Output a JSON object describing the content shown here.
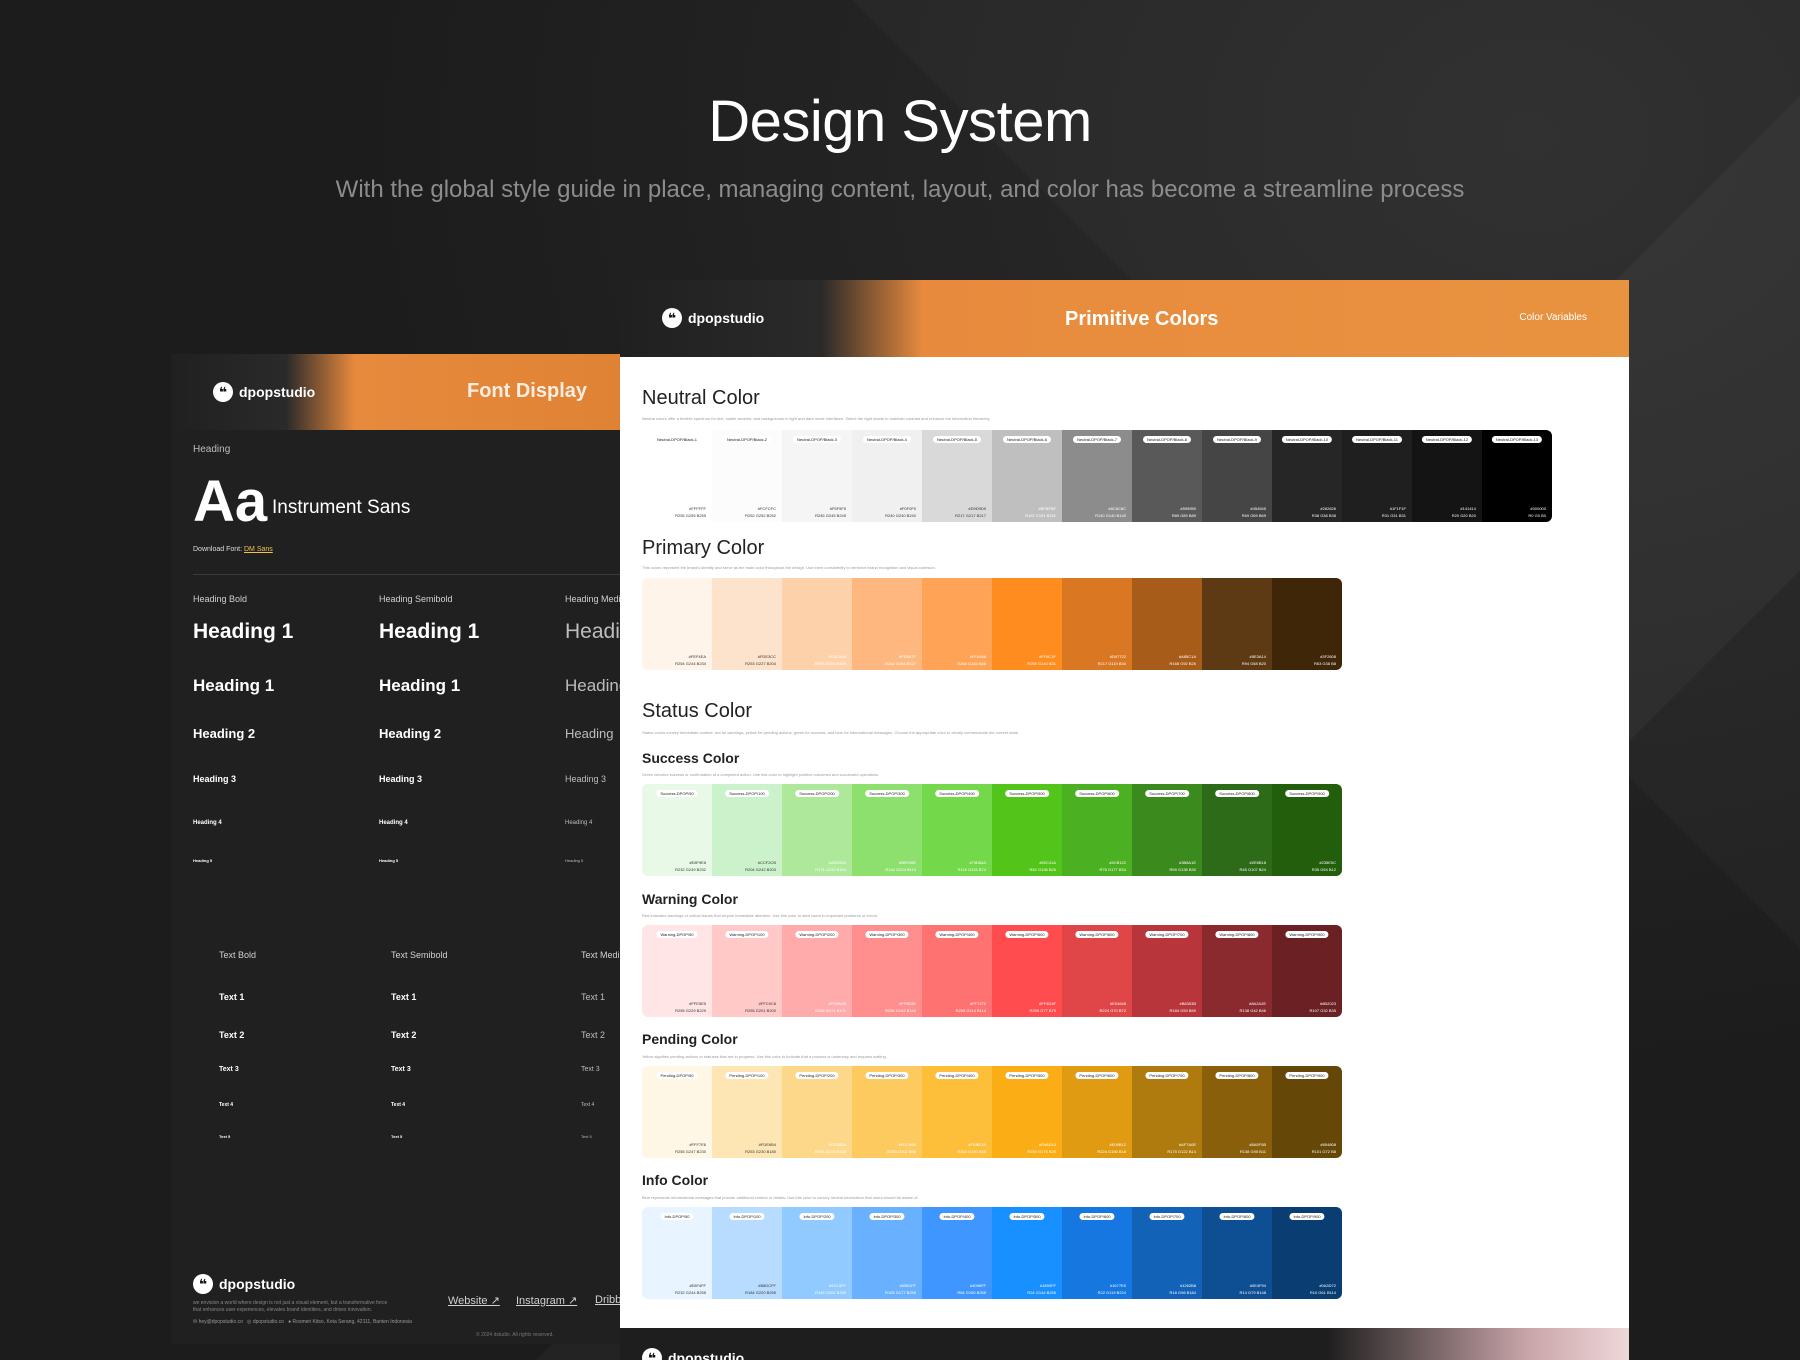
{
  "hero": {
    "title": "Design System",
    "subtitle": "With the global style guide in place, managing content, layout, and color has become a streamline process"
  },
  "brand": {
    "name": "dpopstudio",
    "mark": "❝"
  },
  "font_card": {
    "title": "Font Display",
    "heading_label": "Heading",
    "aa": "Aa",
    "font_name": "Instrument Sans",
    "download_prefix": "Download Font:",
    "download_link": "DM Sans",
    "columns": [
      {
        "label": "Heading Bold",
        "items": [
          "Heading 1",
          "Heading 1",
          "Heading 2",
          "Heading 3",
          "Heading 4",
          "Heading 5"
        ],
        "text_label": "Text Bold",
        "text_items": [
          "Text 1",
          "Text 2",
          "Text 3",
          "Text 4",
          "Text 5"
        ]
      },
      {
        "label": "Heading Semibold",
        "items": [
          "Heading 1",
          "Heading 1",
          "Heading 2",
          "Heading 3",
          "Heading 4",
          "Heading 5"
        ],
        "text_label": "Text Semibold",
        "text_items": [
          "Text 1",
          "Text 2",
          "Text 3",
          "Text 4",
          "Text 5"
        ]
      },
      {
        "label": "Heading Medi",
        "items": [
          "Headi",
          "Heading",
          "Heading",
          "Heading 3",
          "Heading 4",
          "Heading 5"
        ],
        "text_label": "Text Medi",
        "text_items": [
          "Text 1",
          "Text 2",
          "Text 3",
          "Text 4",
          "Text 5"
        ]
      }
    ],
    "footer": {
      "about": "we envision a world where design is not just a visual element, but a transformative force that enhances user experiences, elevates brand identities, and drives innovation.",
      "email": "hey@dpopstudio.co",
      "phone": "dpopstudio.co",
      "address": "Rosmeri Kitso, Kota Serang, 42111, Banten Indonesia",
      "links": [
        "Website ↗",
        "Instagram ↗",
        "Dribb"
      ],
      "copyright": "© 2024 dstudio. All rights reserved."
    }
  },
  "color_card": {
    "title": "Primitive Colors",
    "variables_label": "Color Variables",
    "neutral": {
      "title": "Neutral Color",
      "desc": "Neutral colors offer a flexible spectrum for text, subtle accents, and backgrounds in light and dark mode interfaces. Select the right shade to maintain contrast and enhance the information hierarchy.",
      "swatches": [
        {
          "name": "Neutral-DPOP/Black-1",
          "hex": "#FFFFFF",
          "rgb": "R255 G255 B255",
          "color": "#ffffff",
          "text": "#333"
        },
        {
          "name": "Neutral-DPOP/Black-2",
          "hex": "#FCFCFC",
          "rgb": "R252 G252 B252",
          "color": "#fcfcfc",
          "text": "#333"
        },
        {
          "name": "Neutral-DPOP/Black-3",
          "hex": "#F5F5F5",
          "rgb": "R245 G245 B245",
          "color": "#f5f5f5",
          "text": "#333"
        },
        {
          "name": "Neutral-DPOP/Black-4",
          "hex": "#F0F0F0",
          "rgb": "R240 G240 B240",
          "color": "#f0f0f0",
          "text": "#333"
        },
        {
          "name": "Neutral-DPOP/Black-5",
          "hex": "#D9D9D9",
          "rgb": "R217 G217 B217",
          "color": "#d9d9d9",
          "text": "#333"
        },
        {
          "name": "Neutral-DPOP/Black-6",
          "hex": "#BFBFBF",
          "rgb": "R191 G191 B191",
          "color": "#bfbfbf",
          "text": "#fff"
        },
        {
          "name": "Neutral-DPOP/Black-7",
          "hex": "#8C8C8C",
          "rgb": "R140 G140 B140",
          "color": "#8c8c8c",
          "text": "#fff"
        },
        {
          "name": "Neutral-DPOP/Black-8",
          "hex": "#595959",
          "rgb": "R89 G89 B89",
          "color": "#595959",
          "text": "#fff"
        },
        {
          "name": "Neutral-DPOP/Black-9",
          "hex": "#454545",
          "rgb": "R69 G69 B69",
          "color": "#454545",
          "text": "#fff"
        },
        {
          "name": "Neutral-DPOP/Black-10",
          "hex": "#262626",
          "rgb": "R38 G38 B38",
          "color": "#262626",
          "text": "#fff"
        },
        {
          "name": "Neutral-DPOP/Black-11",
          "hex": "#1F1F1F",
          "rgb": "R31 G31 B31",
          "color": "#1f1f1f",
          "text": "#fff"
        },
        {
          "name": "Neutral-DPOP/Black-12",
          "hex": "#141414",
          "rgb": "R20 G20 B20",
          "color": "#141414",
          "text": "#fff"
        },
        {
          "name": "Neutral-DPOP/Black-13",
          "hex": "#000000",
          "rgb": "R0 G0 B0",
          "color": "#000000",
          "text": "#fff"
        }
      ]
    },
    "primary": {
      "title": "Primary Color",
      "desc": "This colors represent the brand's identity and serve as the main color throughout the design. Use them consistently to reinforce brand recognition and visual cohesion.",
      "swatches": [
        {
          "name": "",
          "hex": "#FEF4EA",
          "rgb": "R254 G244 B234",
          "color": "#fef4ea",
          "text": "#333"
        },
        {
          "name": "",
          "hex": "#FDE3CC",
          "rgb": "R253 G227 B204",
          "color": "#fde3cc",
          "text": "#333"
        },
        {
          "name": "",
          "hex": "#FDD1A9",
          "rgb": "R253 G209 B169",
          "color": "#fdd1a9",
          "text": "#fff"
        },
        {
          "name": "",
          "hex": "#FEB87F",
          "rgb": "R254 G184 B127",
          "color": "#feb87f",
          "text": "#fff"
        },
        {
          "name": "",
          "hex": "#FFA456",
          "rgb": "R255 G164 B86",
          "color": "#ffa456",
          "text": "#fff"
        },
        {
          "name": "",
          "hex": "#FF8C1F",
          "rgb": "R255 G140 B31",
          "color": "#ff8c1f",
          "text": "#fff"
        },
        {
          "name": "",
          "hex": "#D97722",
          "rgb": "R217 G119 B34",
          "color": "#d97722",
          "text": "#fff"
        },
        {
          "name": "",
          "hex": "#A85C1A",
          "rgb": "R168 G92 B26",
          "color": "#a85c1a",
          "text": "#fff"
        },
        {
          "name": "",
          "hex": "#5E3A14",
          "rgb": "R94 G58 B20",
          "color": "#5e3a14",
          "text": "#fff"
        },
        {
          "name": "",
          "hex": "#3F2608",
          "rgb": "R63 G38 B8",
          "color": "#3f2608",
          "text": "#fff"
        }
      ]
    },
    "status": {
      "title": "Status Color",
      "desc": "Status colors convey immediate context: red for warnings, yellow for pending actions, green for success, and blue for informational messages. Choose the appropriate color to clearly communicate the current state.",
      "groups": [
        {
          "title": "Success Color",
          "desc": "Green denotes success or confirmation of a completed action. Use this color to highlight positive outcomes and successful operations.",
          "swatches": [
            {
              "name": "Success-DPOP/50",
              "hex": "#E8F9E8",
              "rgb": "R232 G249 B232",
              "color": "#e8f9e8",
              "text": "#333"
            },
            {
              "name": "Success-DPOP/100",
              "hex": "#CCF2CB",
              "rgb": "R204 G242 B203",
              "color": "#ccf2cb",
              "text": "#333"
            },
            {
              "name": "Success-DPOP/200",
              "hex": "#AEE89A",
              "rgb": "R174 G232 B154",
              "color": "#aee89a",
              "text": "#fff"
            },
            {
              "name": "Success-DPOP/300",
              "hex": "#8EE06E",
              "rgb": "R142 G224 B110",
              "color": "#8ee06e",
              "text": "#fff"
            },
            {
              "name": "Success-DPOP/400",
              "hex": "#73D84A",
              "rgb": "R115 G216 B74",
              "color": "#73d84a",
              "text": "#fff"
            },
            {
              "name": "Success-DPOP/500",
              "hex": "#52C41A",
              "rgb": "R82 G196 B26",
              "color": "#52c41a",
              "text": "#fff"
            },
            {
              "name": "Success-DPOP/600",
              "hex": "#4CB122",
              "rgb": "R76 G177 B34",
              "color": "#4cb122",
              "text": "#fff"
            },
            {
              "name": "Success-DPOP/700",
              "hex": "#3B8A1E",
              "rgb": "R59 G138 B30",
              "color": "#3b8a1e",
              "text": "#fff"
            },
            {
              "name": "Success-DPOP/800",
              "hex": "#2E6B18",
              "rgb": "R46 G107 B24",
              "color": "#2e6b18",
              "text": "#fff"
            },
            {
              "name": "Success-DPOP/900",
              "hex": "#235E0C",
              "rgb": "R35 G94 B12",
              "color": "#235e0c",
              "text": "#fff"
            }
          ]
        },
        {
          "title": "Warning Color",
          "desc": "Red indicates warnings or critical issues that require immediate attention. Use this color to alert users to important problems or errors.",
          "swatches": [
            {
              "name": "Warning-DPOP/50",
              "hex": "#FFE5E5",
              "rgb": "R255 G229 B229",
              "color": "#ffe5e5",
              "text": "#333"
            },
            {
              "name": "Warning-DPOP/100",
              "hex": "#FFC9C8",
              "rgb": "R255 G201 B200",
              "color": "#ffc9c8",
              "text": "#333"
            },
            {
              "name": "Warning-DPOP/200",
              "hex": "#FFABAB",
              "rgb": "R255 G171 B171",
              "color": "#ffabab",
              "text": "#fff"
            },
            {
              "name": "Warning-DPOP/300",
              "hex": "#FF8E8E",
              "rgb": "R255 G142 B142",
              "color": "#ff8e8e",
              "text": "#fff"
            },
            {
              "name": "Warning-DPOP/400",
              "hex": "#FF7272",
              "rgb": "R255 G114 B114",
              "color": "#ff7272",
              "text": "#fff"
            },
            {
              "name": "Warning-DPOP/500",
              "hex": "#FF4D4F",
              "rgb": "R255 G77 B79",
              "color": "#ff4d4f",
              "text": "#fff"
            },
            {
              "name": "Warning-DPOP/600",
              "hex": "#E04648",
              "rgb": "R224 G70 B72",
              "color": "#e04648",
              "text": "#fff"
            },
            {
              "name": "Warning-DPOP/700",
              "hex": "#B8353B",
              "rgb": "R184 G53 B59",
              "color": "#b8353b",
              "text": "#fff"
            },
            {
              "name": "Warning-DPOP/800",
              "hex": "#8A2A2E",
              "rgb": "R138 G42 B46",
              "color": "#8a2a2e",
              "text": "#fff"
            },
            {
              "name": "Warning-DPOP/900",
              "hex": "#6B2023",
              "rgb": "R107 G32 B35",
              "color": "#6b2023",
              "text": "#fff"
            }
          ]
        },
        {
          "title": "Pending Color",
          "desc": "Yellow signifies pending actions or statuses that are in progress. Use this color to indicate that a process is underway and requires waiting.",
          "swatches": [
            {
              "name": "Pending-DPOP/50",
              "hex": "#FFF7E6",
              "rgb": "R255 G247 B230",
              "color": "#fff7e6",
              "text": "#333"
            },
            {
              "name": "Pending-DPOP/100",
              "hex": "#FDE6B4",
              "rgb": "R253 G230 B180",
              "color": "#fde6b4",
              "text": "#333"
            },
            {
              "name": "Pending-DPOP/200",
              "hex": "#FED88A",
              "rgb": "R254 G216 B138",
              "color": "#fed88a",
              "text": "#fff"
            },
            {
              "name": "Pending-DPOP/300",
              "hex": "#FDCA60",
              "rgb": "R253 G202 B96",
              "color": "#fdca60",
              "text": "#fff"
            },
            {
              "name": "Pending-DPOP/400",
              "hex": "#FDBE3A",
              "rgb": "R253 G190 B58",
              "color": "#fdbe3a",
              "text": "#fff"
            },
            {
              "name": "Pending-DPOP/500",
              "hex": "#FAAD14",
              "rgb": "R250 G173 B20",
              "color": "#faad14",
              "text": "#fff"
            },
            {
              "name": "Pending-DPOP/600",
              "hex": "#E09B12",
              "rgb": "R224 G155 B18",
              "color": "#e09b12",
              "text": "#fff"
            },
            {
              "name": "Pending-DPOP/700",
              "hex": "#AF7A0E",
              "rgb": "R175 G122 B14",
              "color": "#af7a0e",
              "text": "#fff"
            },
            {
              "name": "Pending-DPOP/800",
              "hex": "#8A5F0B",
              "rgb": "R138 G95 B11",
              "color": "#8a5f0b",
              "text": "#fff"
            },
            {
              "name": "Pending-DPOP/900",
              "hex": "#654808",
              "rgb": "R101 G72 B8",
              "color": "#654808",
              "text": "#fff"
            }
          ]
        },
        {
          "title": "Info Color",
          "desc": "Blue represents informational messages that provide additional context or details. Use this color to convey neutral information that users should be aware of.",
          "swatches": [
            {
              "name": "Info-DPOP/50",
              "hex": "#E8F4FF",
              "rgb": "R232 G244 B255",
              "color": "#e8f4ff",
              "text": "#333"
            },
            {
              "name": "Info-DPOP/100",
              "hex": "#B8DCFF",
              "rgb": "R184 G220 B255",
              "color": "#b8dcff",
              "text": "#333"
            },
            {
              "name": "Info-DPOP/200",
              "hex": "#91CAFF",
              "rgb": "R145 G202 B255",
              "color": "#91caff",
              "text": "#fff"
            },
            {
              "name": "Info-DPOP/300",
              "hex": "#69B1FF",
              "rgb": "R105 G177 B255",
              "color": "#69b1ff",
              "text": "#fff"
            },
            {
              "name": "Info-DPOP/400",
              "hex": "#4096FF",
              "rgb": "R64 G150 B255",
              "color": "#4096ff",
              "text": "#fff"
            },
            {
              "name": "Info-DPOP/500",
              "hex": "#1890FF",
              "rgb": "R24 G144 B255",
              "color": "#1890ff",
              "text": "#fff"
            },
            {
              "name": "Info-DPOP/600",
              "hex": "#1677E0",
              "rgb": "R22 G119 B224",
              "color": "#1677e0",
              "text": "#fff"
            },
            {
              "name": "Info-DPOP/700",
              "hex": "#1262B8",
              "rgb": "R18 G98 B184",
              "color": "#1262b8",
              "text": "#fff"
            },
            {
              "name": "Info-DPOP/800",
              "hex": "#0E4F94",
              "rgb": "R14 G79 B148",
              "color": "#0e4f94",
              "text": "#fff"
            },
            {
              "name": "Info-DPOP/900",
              "hex": "#0A3D72",
              "rgb": "R10 G61 B114",
              "color": "#0a3d72",
              "text": "#fff"
            }
          ]
        }
      ]
    }
  },
  "colors": {
    "accent": "#E88A3D",
    "background": "#1C1C1C"
  }
}
